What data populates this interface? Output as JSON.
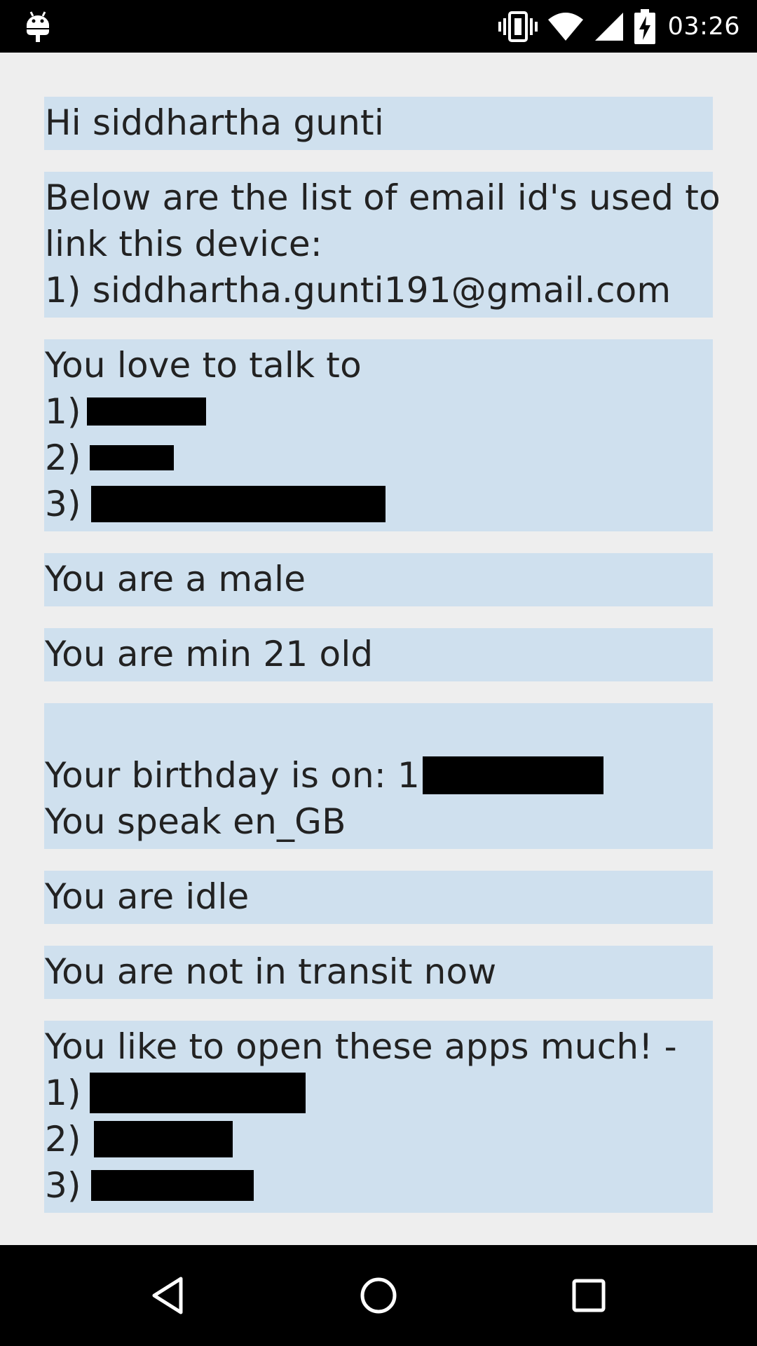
{
  "status_bar": {
    "time": "03:26",
    "icons": [
      "android-icon",
      "vibrate-icon",
      "wifi-icon",
      "signal-icon",
      "battery-charging-icon"
    ]
  },
  "cards": {
    "greeting": "Hi siddhartha gunti",
    "emails": {
      "intro_line1": "Below are the list of email id's used to",
      "intro_line2": "link this device:",
      "items": [
        "1) siddhartha.gunti191@gmail.com"
      ]
    },
    "contacts": {
      "heading": "You love to talk to",
      "items": [
        "1)",
        "2)",
        "3)"
      ]
    },
    "gender": "You are a male",
    "age": "You are min 21 old",
    "profile": {
      "birthday": "Your birthday is on: 1",
      "language": "You speak en_GB"
    },
    "activity": "You are idle",
    "transit": "You are not in transit now",
    "apps": {
      "heading": "You like to open these apps much! -",
      "items": [
        "1)",
        "2)",
        "3)"
      ]
    }
  },
  "nav_bar": {
    "buttons": [
      "back",
      "home",
      "recents"
    ]
  },
  "colors": {
    "card_background": "#cfe0ee",
    "page_background": "#eeeeee",
    "text": "#222222",
    "bars": "#000000"
  }
}
